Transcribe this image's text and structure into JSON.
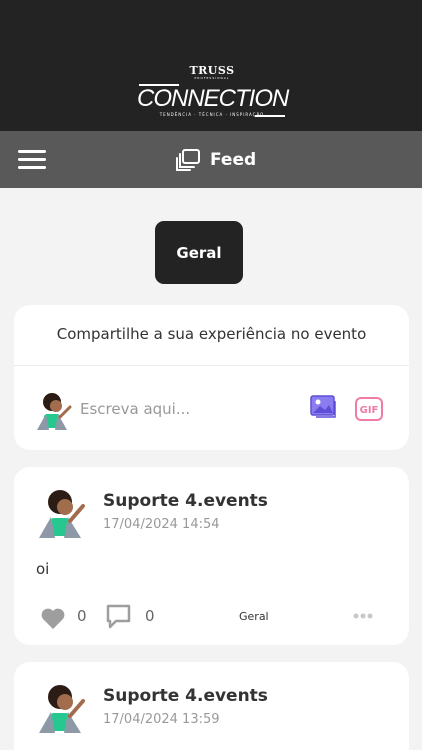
{
  "brand": {
    "logo_top": "TRUSS",
    "logo_sub": "PROFESSIONAL",
    "logo_main": "CONNECTION",
    "logo_tagline": "TENDÊNCIA · TÉCNICA · INSPIRAÇÃO"
  },
  "navbar": {
    "title": "Feed",
    "menu_icon": "hamburger-menu-icon",
    "feed_icon": "feed-gallery-icon"
  },
  "tabs": [
    {
      "label": "Geral",
      "active": true
    }
  ],
  "composer": {
    "title": "Compartilhe a sua experiência no evento",
    "placeholder": "Escreva aqui...",
    "image_icon": "image-upload-icon",
    "gif_icon": "gif-icon"
  },
  "posts": [
    {
      "author": "Suporte 4.events",
      "date": "17/04/2024 14:54",
      "text": "oi",
      "likes": "0",
      "comments": "0",
      "tag": "Geral"
    },
    {
      "author": "Suporte 4.events",
      "date": "17/04/2024 13:59"
    }
  ],
  "colors": {
    "header": "#232323",
    "navbar": "#595959",
    "background": "#f3f3f3",
    "image_icon_accent": "#7868e6",
    "gif_icon_accent": "#ef7ba6"
  }
}
